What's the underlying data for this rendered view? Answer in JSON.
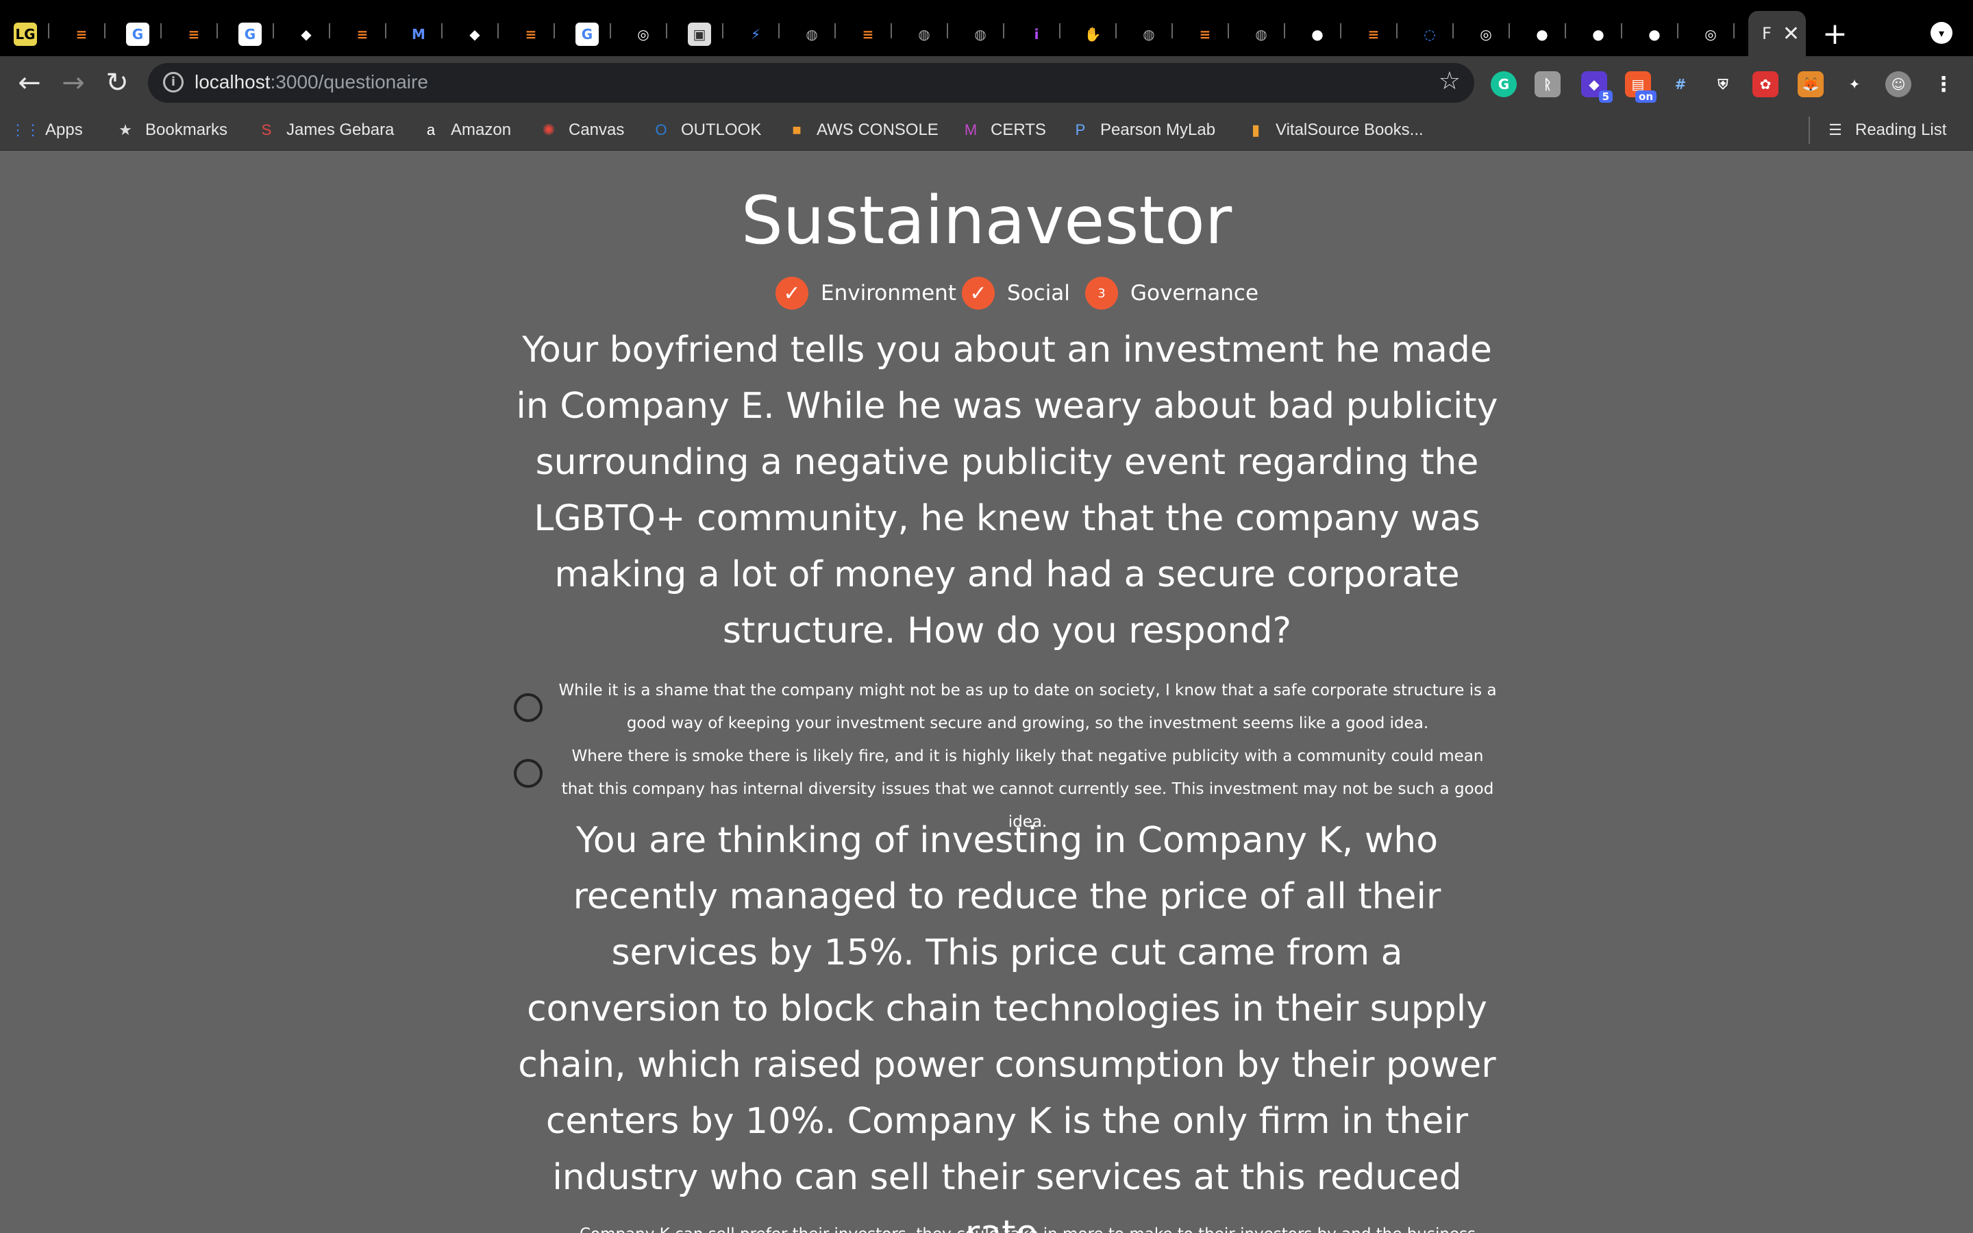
{
  "browser": {
    "tabs": [
      {
        "icon": "LG",
        "color": "#e8d44d",
        "text_color": "#000"
      },
      {
        "icon": "≡",
        "color": "#000",
        "text_color": "#f48024"
      },
      {
        "icon": "G",
        "color": "#fff",
        "text_color": "#4285f4"
      },
      {
        "icon": "≡",
        "color": "#000",
        "text_color": "#f48024"
      },
      {
        "icon": "G",
        "color": "#fff",
        "text_color": "#4285f4"
      },
      {
        "icon": "◆",
        "color": "#000",
        "text_color": "#fff"
      },
      {
        "icon": "≡",
        "color": "#000",
        "text_color": "#f48024"
      },
      {
        "icon": "M",
        "color": "#000",
        "text_color": "#5b8cff"
      },
      {
        "icon": "◆",
        "color": "#000",
        "text_color": "#fff"
      },
      {
        "icon": "≡",
        "color": "#000",
        "text_color": "#f48024"
      },
      {
        "icon": "G",
        "color": "#fff",
        "text_color": "#4285f4"
      },
      {
        "icon": "◎",
        "color": "#000",
        "text_color": "#fff"
      },
      {
        "icon": "▣",
        "color": "#ddd",
        "text_color": "#333"
      },
      {
        "icon": "⚡",
        "color": "#000",
        "text_color": "#4a90ff"
      },
      {
        "icon": "◍",
        "color": "#000",
        "text_color": "#aaa"
      },
      {
        "icon": "≡",
        "color": "#000",
        "text_color": "#f48024"
      },
      {
        "icon": "◍",
        "color": "#000",
        "text_color": "#aaa"
      },
      {
        "icon": "◍",
        "color": "#000",
        "text_color": "#aaa"
      },
      {
        "icon": "i",
        "color": "#000",
        "text_color": "#b04cff"
      },
      {
        "icon": "✋",
        "color": "#000",
        "text_color": "#ffb020"
      },
      {
        "icon": "◍",
        "color": "#000",
        "text_color": "#aaa"
      },
      {
        "icon": "≡",
        "color": "#000",
        "text_color": "#f48024"
      },
      {
        "icon": "◍",
        "color": "#000",
        "text_color": "#aaa"
      },
      {
        "icon": "●",
        "color": "#000",
        "text_color": "#fff"
      },
      {
        "icon": "≡",
        "color": "#000",
        "text_color": "#f48024"
      },
      {
        "icon": "◌",
        "color": "#000",
        "text_color": "#3a8bff"
      },
      {
        "icon": "◎",
        "color": "#000",
        "text_color": "#fff"
      },
      {
        "icon": "●",
        "color": "#000",
        "text_color": "#fff"
      },
      {
        "icon": "●",
        "color": "#000",
        "text_color": "#fff"
      },
      {
        "icon": "●",
        "color": "#000",
        "text_color": "#fff"
      },
      {
        "icon": "◎",
        "color": "#000",
        "text_color": "#fff"
      }
    ],
    "active_tab": {
      "title": "F",
      "close": "✕"
    },
    "new_tab": "+",
    "url_host": "localhost",
    "url_path": ":3000/questionaire",
    "bookmarks": [
      {
        "label": "Apps",
        "icon": "⋮⋮",
        "icon_color": "#4285f4"
      },
      {
        "label": "Bookmarks",
        "icon": "★",
        "icon_color": "#ddd"
      },
      {
        "label": "James Gebara",
        "icon": "S",
        "icon_color": "#e24a4a"
      },
      {
        "label": "Amazon",
        "icon": "a",
        "icon_color": "#fff"
      },
      {
        "label": "Canvas",
        "icon": "✺",
        "icon_color": "#e2463a"
      },
      {
        "label": "OUTLOOK",
        "icon": "O",
        "icon_color": "#2b7cd3"
      },
      {
        "label": "AWS CONSOLE",
        "icon": "■",
        "icon_color": "#f09a2b"
      },
      {
        "label": "CERTS",
        "icon": "M",
        "icon_color": "#c04cc8"
      },
      {
        "label": "Pearson MyLab",
        "icon": "P",
        "icon_color": "#6aa8ff"
      },
      {
        "label": "VitalSource Books...",
        "icon": "▮",
        "icon_color": "#f0a030"
      }
    ],
    "reading_list": "Reading List"
  },
  "app": {
    "title": "Sustainavestor",
    "steps": [
      {
        "label": "Environment",
        "state": "done",
        "glyph": "✓"
      },
      {
        "label": "Social",
        "state": "done",
        "glyph": "✓"
      },
      {
        "label": "Governance",
        "state": "current",
        "glyph": "3"
      }
    ],
    "accent": "#f05a33",
    "questions": [
      {
        "text": "Your boyfriend tells you about an investment he made in Company E. While he was weary about bad publicity surrounding a negative publicity event regarding the LGBTQ+ community, he knew that the company was making a lot of money and had a secure corporate structure. How do you respond?",
        "answers": [
          "While it is a shame that the company might not be as up to date on society, I know that a safe corporate structure is a good way of keeping your investment secure and growing, so the investment seems like a good idea.",
          "Where there is smoke there is likely fire, and it is highly likely that negative publicity with a community could mean that this company has internal diversity issues that we cannot currently see. This investment may not be such a good idea."
        ]
      },
      {
        "text": "You are thinking of investing in Company K, who recently managed to reduce the price of all their services by 15%. This price cut came from a conversion to block chain technologies in their supply chain, which raised power consumption by their power centers by 10%. Company K is the only firm in their industry who can sell their services at this reduced rate.",
        "answers": [
          "Company K can sell prefer their investors, they could take in more to make to their investors by and the business"
        ]
      }
    ]
  }
}
